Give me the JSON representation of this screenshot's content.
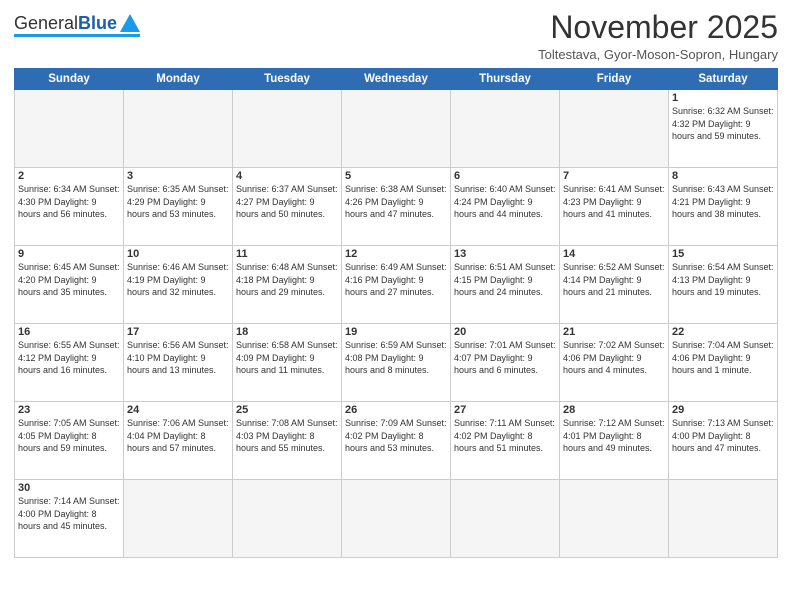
{
  "header": {
    "logo": {
      "general": "General",
      "blue": "Blue"
    },
    "title": "November 2025",
    "subtitle": "Toltestava, Gyor-Moson-Sopron, Hungary"
  },
  "days_of_week": [
    "Sunday",
    "Monday",
    "Tuesday",
    "Wednesday",
    "Thursday",
    "Friday",
    "Saturday"
  ],
  "weeks": [
    {
      "days": [
        {
          "number": "",
          "info": ""
        },
        {
          "number": "",
          "info": ""
        },
        {
          "number": "",
          "info": ""
        },
        {
          "number": "",
          "info": ""
        },
        {
          "number": "",
          "info": ""
        },
        {
          "number": "",
          "info": ""
        },
        {
          "number": "1",
          "info": "Sunrise: 6:32 AM\nSunset: 4:32 PM\nDaylight: 9 hours\nand 59 minutes."
        }
      ]
    },
    {
      "days": [
        {
          "number": "2",
          "info": "Sunrise: 6:34 AM\nSunset: 4:30 PM\nDaylight: 9 hours\nand 56 minutes."
        },
        {
          "number": "3",
          "info": "Sunrise: 6:35 AM\nSunset: 4:29 PM\nDaylight: 9 hours\nand 53 minutes."
        },
        {
          "number": "4",
          "info": "Sunrise: 6:37 AM\nSunset: 4:27 PM\nDaylight: 9 hours\nand 50 minutes."
        },
        {
          "number": "5",
          "info": "Sunrise: 6:38 AM\nSunset: 4:26 PM\nDaylight: 9 hours\nand 47 minutes."
        },
        {
          "number": "6",
          "info": "Sunrise: 6:40 AM\nSunset: 4:24 PM\nDaylight: 9 hours\nand 44 minutes."
        },
        {
          "number": "7",
          "info": "Sunrise: 6:41 AM\nSunset: 4:23 PM\nDaylight: 9 hours\nand 41 minutes."
        },
        {
          "number": "8",
          "info": "Sunrise: 6:43 AM\nSunset: 4:21 PM\nDaylight: 9 hours\nand 38 minutes."
        }
      ]
    },
    {
      "days": [
        {
          "number": "9",
          "info": "Sunrise: 6:45 AM\nSunset: 4:20 PM\nDaylight: 9 hours\nand 35 minutes."
        },
        {
          "number": "10",
          "info": "Sunrise: 6:46 AM\nSunset: 4:19 PM\nDaylight: 9 hours\nand 32 minutes."
        },
        {
          "number": "11",
          "info": "Sunrise: 6:48 AM\nSunset: 4:18 PM\nDaylight: 9 hours\nand 29 minutes."
        },
        {
          "number": "12",
          "info": "Sunrise: 6:49 AM\nSunset: 4:16 PM\nDaylight: 9 hours\nand 27 minutes."
        },
        {
          "number": "13",
          "info": "Sunrise: 6:51 AM\nSunset: 4:15 PM\nDaylight: 9 hours\nand 24 minutes."
        },
        {
          "number": "14",
          "info": "Sunrise: 6:52 AM\nSunset: 4:14 PM\nDaylight: 9 hours\nand 21 minutes."
        },
        {
          "number": "15",
          "info": "Sunrise: 6:54 AM\nSunset: 4:13 PM\nDaylight: 9 hours\nand 19 minutes."
        }
      ]
    },
    {
      "days": [
        {
          "number": "16",
          "info": "Sunrise: 6:55 AM\nSunset: 4:12 PM\nDaylight: 9 hours\nand 16 minutes."
        },
        {
          "number": "17",
          "info": "Sunrise: 6:56 AM\nSunset: 4:10 PM\nDaylight: 9 hours\nand 13 minutes."
        },
        {
          "number": "18",
          "info": "Sunrise: 6:58 AM\nSunset: 4:09 PM\nDaylight: 9 hours\nand 11 minutes."
        },
        {
          "number": "19",
          "info": "Sunrise: 6:59 AM\nSunset: 4:08 PM\nDaylight: 9 hours\nand 8 minutes."
        },
        {
          "number": "20",
          "info": "Sunrise: 7:01 AM\nSunset: 4:07 PM\nDaylight: 9 hours\nand 6 minutes."
        },
        {
          "number": "21",
          "info": "Sunrise: 7:02 AM\nSunset: 4:06 PM\nDaylight: 9 hours\nand 4 minutes."
        },
        {
          "number": "22",
          "info": "Sunrise: 7:04 AM\nSunset: 4:06 PM\nDaylight: 9 hours\nand 1 minute."
        }
      ]
    },
    {
      "days": [
        {
          "number": "23",
          "info": "Sunrise: 7:05 AM\nSunset: 4:05 PM\nDaylight: 8 hours\nand 59 minutes."
        },
        {
          "number": "24",
          "info": "Sunrise: 7:06 AM\nSunset: 4:04 PM\nDaylight: 8 hours\nand 57 minutes."
        },
        {
          "number": "25",
          "info": "Sunrise: 7:08 AM\nSunset: 4:03 PM\nDaylight: 8 hours\nand 55 minutes."
        },
        {
          "number": "26",
          "info": "Sunrise: 7:09 AM\nSunset: 4:02 PM\nDaylight: 8 hours\nand 53 minutes."
        },
        {
          "number": "27",
          "info": "Sunrise: 7:11 AM\nSunset: 4:02 PM\nDaylight: 8 hours\nand 51 minutes."
        },
        {
          "number": "28",
          "info": "Sunrise: 7:12 AM\nSunset: 4:01 PM\nDaylight: 8 hours\nand 49 minutes."
        },
        {
          "number": "29",
          "info": "Sunrise: 7:13 AM\nSunset: 4:00 PM\nDaylight: 8 hours\nand 47 minutes."
        }
      ]
    },
    {
      "days": [
        {
          "number": "30",
          "info": "Sunrise: 7:14 AM\nSunset: 4:00 PM\nDaylight: 8 hours\nand 45 minutes."
        },
        {
          "number": "",
          "info": ""
        },
        {
          "number": "",
          "info": ""
        },
        {
          "number": "",
          "info": ""
        },
        {
          "number": "",
          "info": ""
        },
        {
          "number": "",
          "info": ""
        },
        {
          "number": "",
          "info": ""
        }
      ]
    }
  ]
}
